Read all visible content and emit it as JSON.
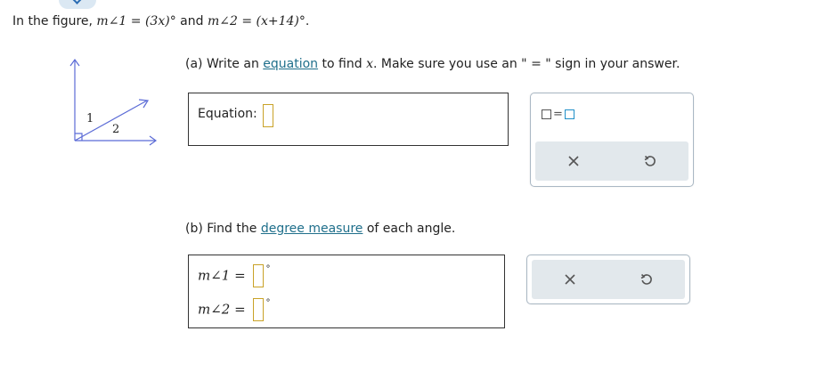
{
  "prompt": {
    "lead": "In the figure,",
    "angle1": "m∠1 = (3x)°",
    "conj": "and",
    "angle2": "m∠2 = (x+14)°",
    "end": "."
  },
  "figure": {
    "label1": "1",
    "label2": "2"
  },
  "part_a": {
    "prefix": "(a) Write an",
    "link": "equation",
    "middle": "to find",
    "var": "x",
    "suffix": ". Make sure you use an \" = \" sign in your answer.",
    "equation_label": "Equation:",
    "equation_value": ""
  },
  "part_b": {
    "prefix": "(b) Find the",
    "link": "degree measure",
    "suffix": "of each angle.",
    "angle1_label": "m∠1 =",
    "angle2_label": "m∠2 =",
    "angle1_value": "",
    "angle2_value": "",
    "degree_symbol": "°"
  },
  "tools": {
    "template_equals": "=",
    "clear_icon": "close-icon",
    "undo_icon": "undo-icon",
    "accent": "#1f8fc8",
    "panel_bar": "#e2e8ec"
  }
}
